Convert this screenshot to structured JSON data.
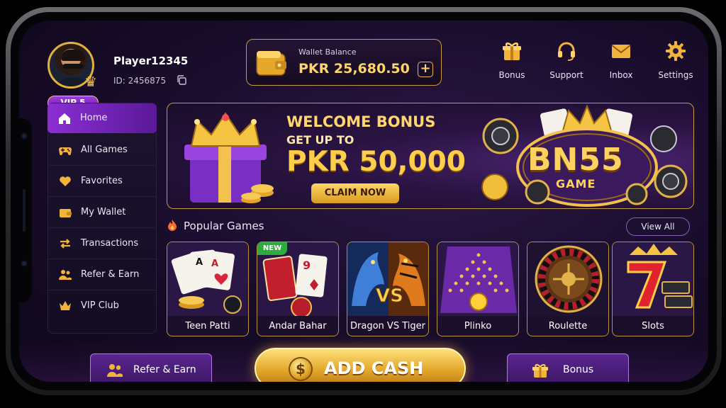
{
  "profile": {
    "name": "Player12345",
    "id_label": "ID: 2456875",
    "vip": "VIP 5"
  },
  "wallet": {
    "label": "Wallet Balance",
    "amount": "PKR 25,680.50",
    "add_symbol": "+"
  },
  "top_nav": [
    {
      "label": "Bonus",
      "icon": "gift-icon"
    },
    {
      "label": "Support",
      "icon": "headset-icon"
    },
    {
      "label": "Inbox",
      "icon": "envelope-icon"
    },
    {
      "label": "Settings",
      "icon": "gear-icon"
    }
  ],
  "sidebar": {
    "items": [
      {
        "label": "Home",
        "icon": "home-icon",
        "active": true
      },
      {
        "label": "All Games",
        "icon": "gamepad-icon"
      },
      {
        "label": "Favorites",
        "icon": "heart-icon"
      },
      {
        "label": "My Wallet",
        "icon": "wallet-icon"
      },
      {
        "label": "Transactions",
        "icon": "transfer-arrows-icon"
      },
      {
        "label": "Refer & Earn",
        "icon": "users-icon"
      },
      {
        "label": "VIP Club",
        "icon": "crown-icon"
      }
    ]
  },
  "banner": {
    "headline": "WELCOME BONUS",
    "subline": "GET UP TO",
    "amount": "PKR 50,000",
    "cta": "CLAIM NOW",
    "logo_text": "BN55",
    "logo_sub": "GAME"
  },
  "popular": {
    "title": "Popular Games",
    "view_all": "View All",
    "games": [
      {
        "label": "Teen Patti"
      },
      {
        "label": "Andar Bahar",
        "tag": "NEW"
      },
      {
        "label": "Dragon VS Tiger",
        "art_text": "VS"
      },
      {
        "label": "Plinko"
      },
      {
        "label": "Roulette"
      },
      {
        "label": "Slots"
      }
    ]
  },
  "bottom": {
    "refer": "Refer & Earn",
    "add_cash": "ADD CASH",
    "bonus": "Bonus",
    "coin_symbol": "$"
  },
  "colors": {
    "accent_gold": "#ffcf4a",
    "accent_purple": "#8b2ed4",
    "background": "#180c2a"
  }
}
